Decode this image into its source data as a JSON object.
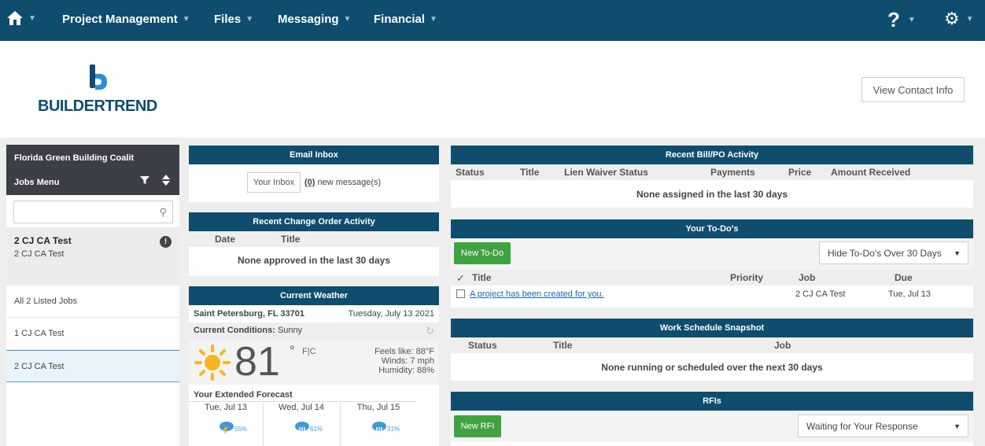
{
  "nav": {
    "items": [
      {
        "label": "Project Management"
      },
      {
        "label": "Files"
      },
      {
        "label": "Messaging"
      },
      {
        "label": "Financial"
      }
    ],
    "help_icon": "question-icon",
    "settings_icon": "gear-icon",
    "home_icon": "home-icon"
  },
  "logo": {
    "text": "BUILDERTREND"
  },
  "contact_button": "View Contact Info",
  "jobs_panel": {
    "builder_name": "Florida Green Building Coalit",
    "menu_title": "Jobs Menu",
    "search_placeholder": "",
    "current_job": {
      "title": "2 CJ CA Test",
      "subtitle": "2 CJ CA Test"
    },
    "list": [
      {
        "label": "All 2 Listed Jobs"
      },
      {
        "label": "1 CJ CA Test"
      },
      {
        "label": "2 CJ CA Test"
      }
    ]
  },
  "email_inbox": {
    "title": "Email Inbox",
    "button": "Your Inbox",
    "count": "(0)",
    "count_suffix": " new message(s)"
  },
  "change_orders": {
    "title": "Recent Change Order Activity",
    "columns": [
      "Date",
      "Title"
    ],
    "empty": "None approved in the last 30 days"
  },
  "weather": {
    "title": "Current Weather",
    "location": "Saint Petersburg, FL 33701",
    "date": "Tuesday, July 13 2021",
    "conditions_label": "Current Conditions:",
    "conditions_value": "Sunny",
    "temp": "81",
    "deg": "°",
    "unit": "F|C",
    "feels_like": "Feels like: 88°F",
    "winds": "Winds: 7 mph",
    "humidity": "Humidity: 88%",
    "forecast_title": "Your Extended Forecast",
    "forecast": [
      {
        "day": "Tue, Jul 13",
        "pct": "55%"
      },
      {
        "day": "Wed, Jul 14",
        "pct": "61%"
      },
      {
        "day": "Thu, Jul 15",
        "pct": "31%"
      }
    ]
  },
  "bill_po": {
    "title": "Recent Bill/PO Activity",
    "columns": [
      "Status",
      "Title",
      "Lien Waiver Status",
      "Payments",
      "Price",
      "Amount Received"
    ],
    "empty": "None assigned in the last 30 days"
  },
  "todos": {
    "title": "Your To-Do's",
    "new_button": "New To-Do",
    "filter": "Hide To-Do's Over 30 Days",
    "columns": [
      "Title",
      "Priority",
      "Job",
      "Due"
    ],
    "rows": [
      {
        "title": "A project has been created for you.",
        "priority": "",
        "job": "2 CJ CA Test",
        "due": "Tue, Jul 13"
      }
    ]
  },
  "schedule": {
    "title": "Work Schedule Snapshot",
    "columns": [
      "Status",
      "Title",
      "Job"
    ],
    "empty": "None running or scheduled over the next 30 days"
  },
  "rfis": {
    "title": "RFIs",
    "new_button": "New RFI",
    "filter": "Waiting for Your Response"
  },
  "colors": {
    "nav": "#0e4d6e",
    "accent_green": "#3fa342",
    "link": "#1f63b5"
  }
}
